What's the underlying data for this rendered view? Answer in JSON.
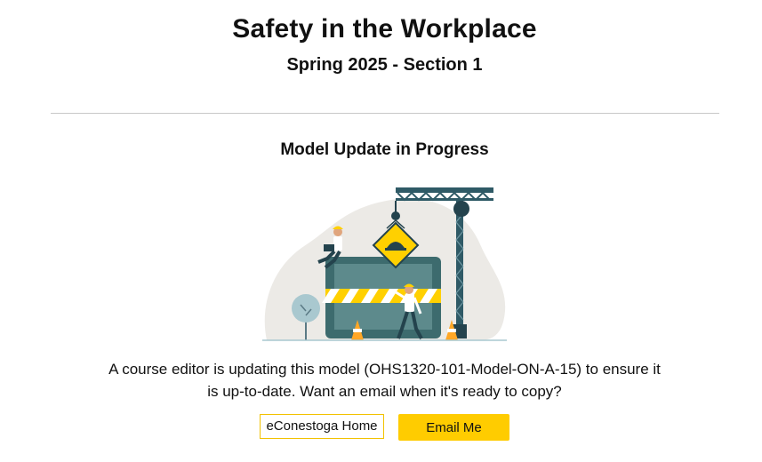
{
  "header": {
    "title": "Safety in the Workplace",
    "subtitle": "Spring 2025 - Section 1"
  },
  "status": {
    "heading": "Model Update in Progress",
    "illustration": "under-construction-illustration",
    "message": "A course editor is updating this model (OHS1320-101-Model-ON-A-15) to ensure it is up-to-date. Want an email when it's ready to copy?"
  },
  "actions": {
    "home_link_label": "eConestoga Home",
    "email_button_label": "Email Me"
  },
  "colors": {
    "accent": "#ffcc00",
    "divider": "#c8c8c8",
    "screen": "#3d6b6e",
    "crane": "#2f5a66"
  }
}
